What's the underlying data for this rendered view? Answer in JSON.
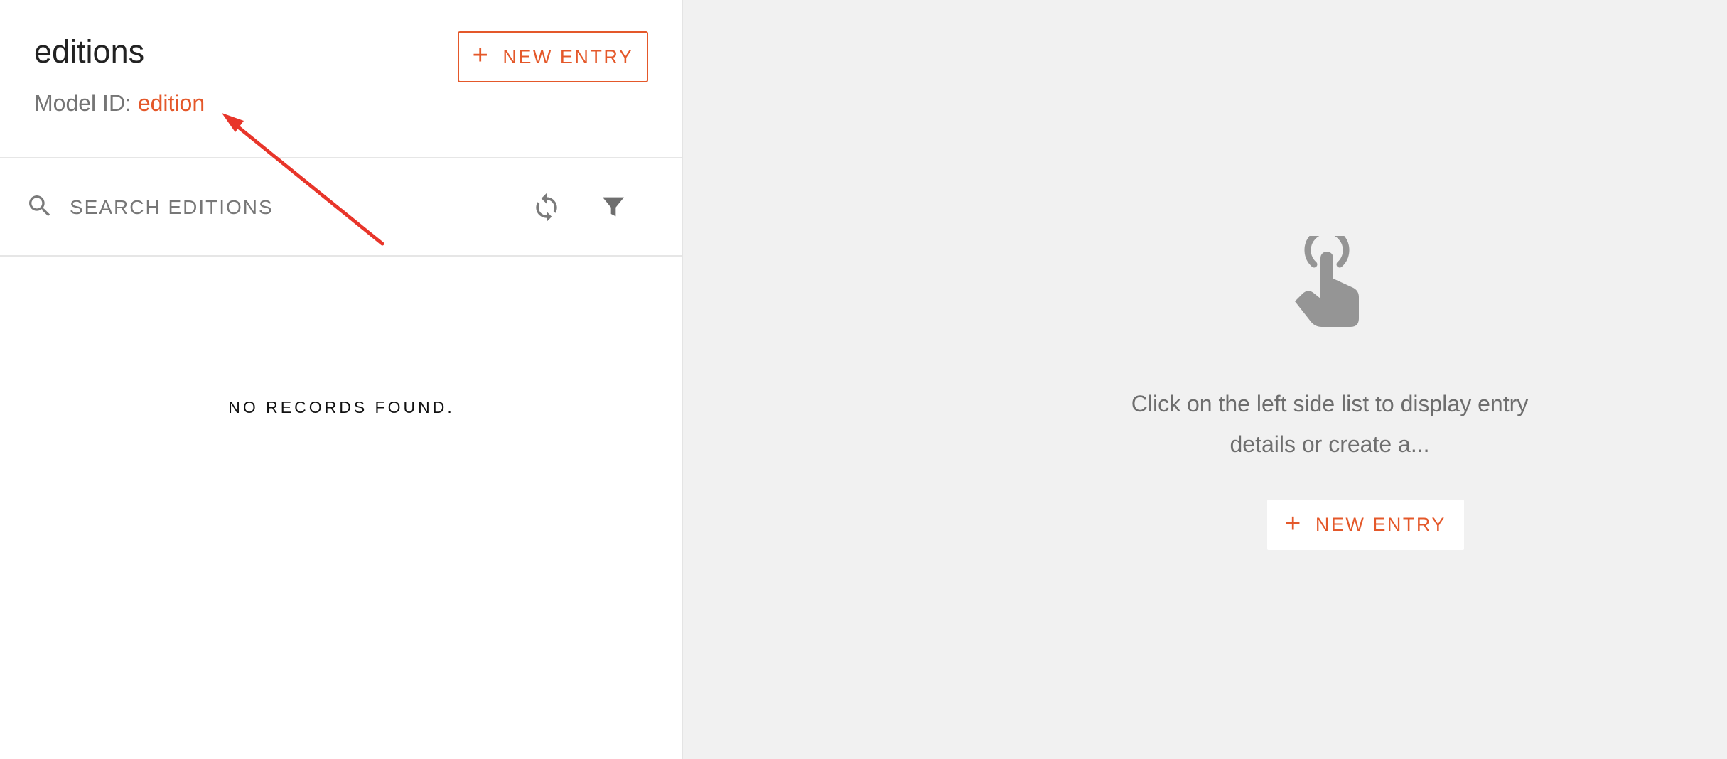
{
  "header": {
    "title": "editions",
    "model_id_label": "Model ID: ",
    "model_id_value": "edition",
    "new_entry_label": "NEW ENTRY"
  },
  "search": {
    "placeholder": "SEARCH EDITIONS"
  },
  "list": {
    "empty_message": "NO RECORDS FOUND."
  },
  "details": {
    "placeholder_line1": "Click on the left side list to display entry",
    "placeholder_line2": "details or create a...",
    "new_entry_label": "NEW ENTRY"
  },
  "icons": {
    "search": "search-icon",
    "refresh": "refresh-icon",
    "filter": "filter-icon",
    "touch": "touch-app-icon",
    "plus": "plus-icon"
  },
  "colors": {
    "accent": "#e4582a",
    "annotation": "#e8352a",
    "panel_background": "#f1f1f1",
    "icon_gray": "#959595"
  }
}
